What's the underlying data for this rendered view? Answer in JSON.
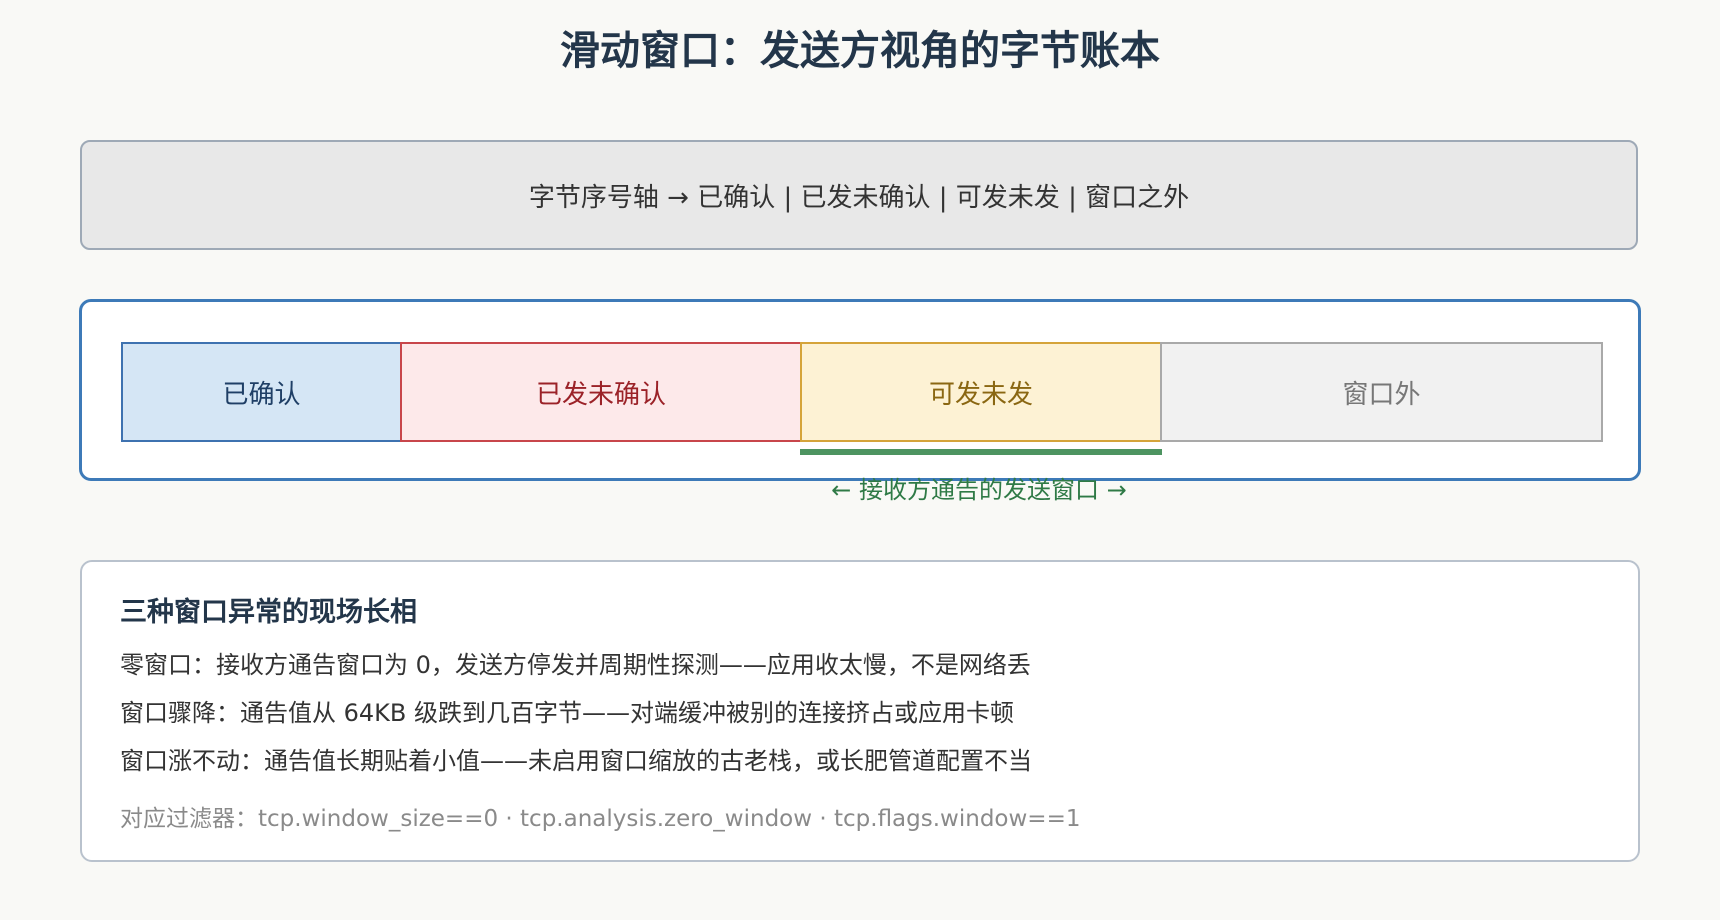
{
  "title": "滑动窗口：发送方视角的字节账本",
  "axis_caption": "字节序号轴 → 已确认 | 已发未确认 | 可发未发 | 窗口之外",
  "segments": {
    "acked": "已确认",
    "unacked": "已发未确认",
    "available": "可发未发",
    "outside": "窗口外"
  },
  "window_label": "← 接收方通告的发送窗口 →",
  "notes": {
    "title": "三种窗口异常的现场长相",
    "lines": [
      "零窗口：接收方通告窗口为 0，发送方停发并周期性探测——应用收太慢，不是网络丢",
      "窗口骤降：通告值从 64KB 级跌到几百字节——对端缓冲被别的连接挤占或应用卡顿",
      "窗口涨不动：通告值长期贴着小值——未启用窗口缩放的古老栈，或长肥管道配置不当"
    ],
    "filters": "对应过滤器：tcp.window_size==0 · tcp.analysis.zero_window · tcp.flags.window==1"
  },
  "colors": {
    "frame_border": "#3d7ab8",
    "acked": "#d5e6f5",
    "unacked": "#fde9ea",
    "available": "#fdf2d4",
    "outside": "#f1f1f1",
    "window_bar": "#4d9461"
  }
}
